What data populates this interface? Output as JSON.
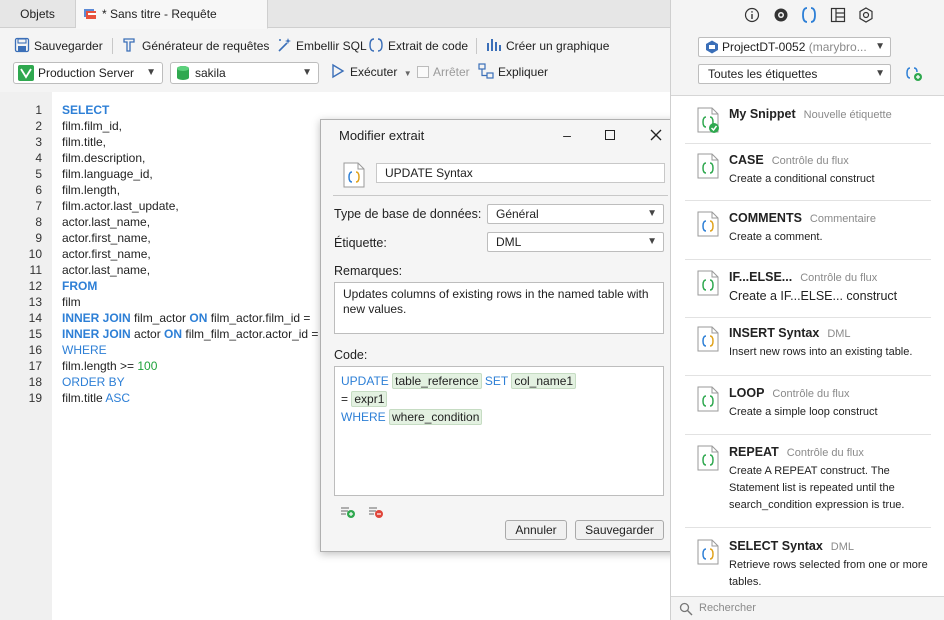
{
  "tabs": {
    "objects": "Objets",
    "query": "* Sans titre - Requête"
  },
  "toolbar": {
    "save": "Sauvegarder",
    "query_builder": "Générateur de requêtes",
    "beautify": "Embellir SQL",
    "snippet": "Extrait de code",
    "chart": "Créer un graphique",
    "connection": "Production Server",
    "database": "sakila",
    "run": "Exécuter",
    "stop": "Arrêter",
    "explain": "Expliquer"
  },
  "editor": {
    "lines": [
      {
        "n": "1",
        "parts": [
          {
            "t": "SELECT",
            "c": "kw"
          }
        ]
      },
      {
        "n": "2",
        "parts": [
          {
            "t": "film.film_id,",
            "c": ""
          }
        ]
      },
      {
        "n": "3",
        "parts": [
          {
            "t": "film.title,",
            "c": ""
          }
        ]
      },
      {
        "n": "4",
        "parts": [
          {
            "t": "film.description,",
            "c": ""
          }
        ]
      },
      {
        "n": "5",
        "parts": [
          {
            "t": "film.language_id,",
            "c": ""
          }
        ]
      },
      {
        "n": "6",
        "parts": [
          {
            "t": "film.length,",
            "c": ""
          }
        ]
      },
      {
        "n": "7",
        "parts": [
          {
            "t": "film.actor.last_update,",
            "c": ""
          }
        ]
      },
      {
        "n": "8",
        "parts": [
          {
            "t": "actor.last_name,",
            "c": ""
          }
        ]
      },
      {
        "n": "9",
        "parts": [
          {
            "t": "actor.first_name,",
            "c": ""
          }
        ]
      },
      {
        "n": "10",
        "parts": [
          {
            "t": "actor.first_name,",
            "c": ""
          }
        ]
      },
      {
        "n": "11",
        "parts": [
          {
            "t": "actor.last_name,",
            "c": ""
          }
        ]
      },
      {
        "n": "12",
        "parts": [
          {
            "t": "FROM",
            "c": "kw"
          }
        ]
      },
      {
        "n": "13",
        "parts": [
          {
            "t": "film",
            "c": ""
          }
        ]
      },
      {
        "n": "14",
        "parts": [
          {
            "t": "INNER JOIN",
            "c": "kw"
          },
          {
            "t": " film_actor ",
            "c": ""
          },
          {
            "t": "ON",
            "c": "kw"
          },
          {
            "t": " film_actor.film_id =",
            "c": ""
          }
        ]
      },
      {
        "n": "15",
        "parts": [
          {
            "t": "INNER JOIN",
            "c": "kw"
          },
          {
            "t": " actor ",
            "c": ""
          },
          {
            "t": "ON",
            "c": "kw"
          },
          {
            "t": " film_film_actor.actor_id =",
            "c": ""
          }
        ]
      },
      {
        "n": "16",
        "parts": [
          {
            "t": "WHERE",
            "c": "kw2"
          }
        ]
      },
      {
        "n": "17",
        "parts": [
          {
            "t": "film.length >= ",
            "c": ""
          },
          {
            "t": "100",
            "c": "num"
          }
        ]
      },
      {
        "n": "18",
        "parts": [
          {
            "t": "ORDER BY",
            "c": "kw2"
          }
        ]
      },
      {
        "n": "19",
        "parts": [
          {
            "t": "film.title ",
            "c": ""
          },
          {
            "t": "ASC",
            "c": "kw2"
          }
        ]
      }
    ]
  },
  "dialog": {
    "title": "Modifier extrait",
    "name": "UPDATE Syntax",
    "db_type_label": "Type de base de données:",
    "db_type_value": "Général",
    "tag_label": "Étiquette:",
    "tag_value": "DML",
    "remarks_label": "Remarques:",
    "remarks": "Updates columns of existing rows in the named table with new values.",
    "code_label": "Code:",
    "code": {
      "update": "UPDATE",
      "table_reference": "table_reference",
      "set": "SET",
      "col_name1": "col_name1",
      "eq": "=",
      "expr1": "expr1",
      "where": "WHERE",
      "where_condition": "where_condition"
    },
    "cancel": "Annuler",
    "save": "Sauvegarder"
  },
  "right_panel": {
    "project": "ProjectDT-0052",
    "project_owner": "(marybro...",
    "tag_filter": "Toutes les étiquettes",
    "snippets": [
      {
        "name": "My Snippet",
        "tag": "Nouvelle étiquette",
        "desc": ""
      },
      {
        "name": "CASE",
        "tag": "Contrôle du flux",
        "desc": "Create a conditional construct"
      },
      {
        "name": "COMMENTS",
        "tag": "Commentaire",
        "desc": "Create a comment."
      },
      {
        "name": "IF...ELSE...",
        "tag": "Contrôle du flux",
        "desc": "Create a IF...ELSE... construct"
      },
      {
        "name": "INSERT Syntax",
        "tag": "DML",
        "desc": "Insert new rows into an existing table."
      },
      {
        "name": "LOOP",
        "tag": "Contrôle du flux",
        "desc": "Create a simple loop construct"
      },
      {
        "name": "REPEAT",
        "tag": "Contrôle du flux",
        "desc": "Create A REPEAT construct. The Statement list is repeated until the search_condition expression is true."
      },
      {
        "name": "SELECT Syntax",
        "tag": "DML",
        "desc": "Retrieve rows selected from one or more tables."
      }
    ],
    "search_placeholder": "Rechercher"
  }
}
